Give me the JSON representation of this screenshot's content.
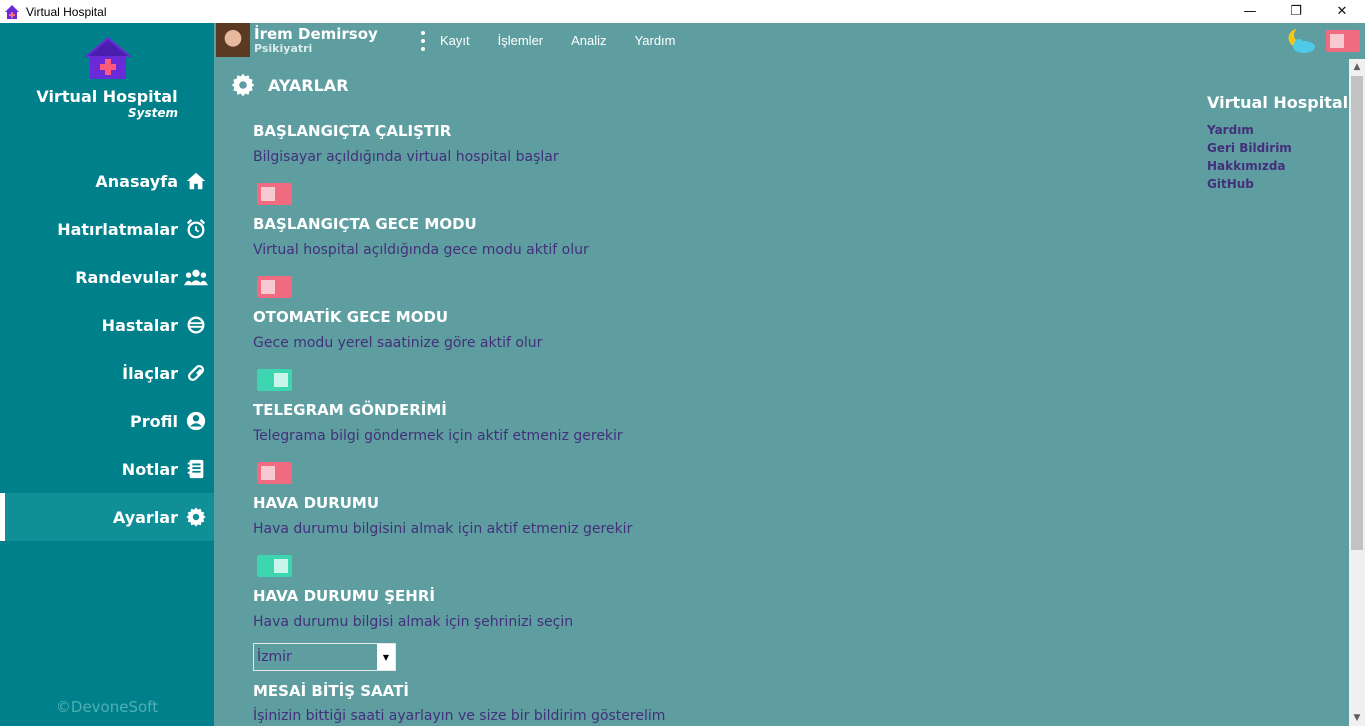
{
  "window": {
    "title": "Virtual Hospital",
    "controls": {
      "minimize": "—",
      "maximize": "❐",
      "close": "✕"
    }
  },
  "sidebar": {
    "brand_name": "Virtual Hospital",
    "brand_sub": "System",
    "items": [
      {
        "label": "Anasayfa",
        "icon": "home-icon"
      },
      {
        "label": "Hatırlatmalar",
        "icon": "alarm-clock-icon"
      },
      {
        "label": "Randevular",
        "icon": "users-icon"
      },
      {
        "label": "Hastalar",
        "icon": "patient-icon"
      },
      {
        "label": "İlaçlar",
        "icon": "pill-icon"
      },
      {
        "label": "Profil",
        "icon": "user-circle-icon"
      },
      {
        "label": "Notlar",
        "icon": "notebook-icon"
      },
      {
        "label": "Ayarlar",
        "icon": "gear-icon",
        "active": true
      }
    ],
    "footer": "©DevoneSoft"
  },
  "topbar": {
    "user_name": "İrem Demirsoy",
    "user_role": "Psikiyatri",
    "menu": [
      "Kayıt",
      "İşlemler",
      "Analiz",
      "Yardım"
    ],
    "night_mode_on": false
  },
  "page": {
    "title": "AYARLAR",
    "settings": [
      {
        "title": "BAŞLANGIÇTA ÇALIŞTIR",
        "desc": "Bilgisayar açıldığında virtual hospital başlar",
        "on": false
      },
      {
        "title": "BAŞLANGIÇTA GECE MODU",
        "desc": "Virtual hospital açıldığında gece modu aktif olur",
        "on": false
      },
      {
        "title": "OTOMATİK GECE MODU",
        "desc": "Gece modu yerel saatinize göre aktif olur",
        "on": true
      },
      {
        "title": "TELEGRAM GÖNDERİMİ",
        "desc": "Telegrama bilgi göndermek için aktif etmeniz gerekir",
        "on": false
      },
      {
        "title": "HAVA DURUMU",
        "desc": "Hava durumu bilgisini almak için aktif etmeniz gerekir",
        "on": true
      },
      {
        "title": "HAVA DURUMU ŞEHRİ",
        "desc": "Hava durumu bilgisi almak için şehrinizi seçin",
        "select_value": "İzmir"
      },
      {
        "title": "MESAİ BİTİŞ SAATİ",
        "desc": "İşinizin bittiği saati ayarlayın ve size bir bildirim gösterelim"
      }
    ]
  },
  "right_panel": {
    "title": "Virtual Hospital",
    "links": [
      "Yardım",
      "Geri Bildirim",
      "Hakkımızda",
      "GitHub"
    ]
  },
  "colors": {
    "sidebar": "#00808a",
    "content": "#5f9ea0",
    "toggle_off": "#f06a80",
    "toggle_on": "#3ed6b0",
    "desc_text": "#42307a"
  }
}
